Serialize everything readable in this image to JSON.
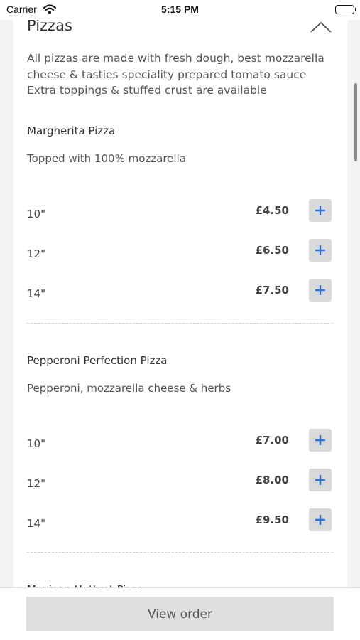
{
  "status_bar": {
    "carrier": "Carrier",
    "time": "5:15 PM"
  },
  "section": {
    "title": "Pizzas",
    "description": "All pizzas are made with fresh dough, best mozzarella cheese & tasties speciality prepared tomato sauce Extra toppings & stuffed crust are available"
  },
  "items": [
    {
      "name": "Margherita Pizza",
      "description": "Topped with 100% mozzarella",
      "sizes": [
        {
          "label": "10\"",
          "price": "£4.50"
        },
        {
          "label": "12\"",
          "price": "£6.50"
        },
        {
          "label": "14\"",
          "price": "£7.50"
        }
      ]
    },
    {
      "name": "Pepperoni Perfection Pizza",
      "description": "Pepperoni, mozzarella cheese & herbs",
      "sizes": [
        {
          "label": "10\"",
          "price": "£7.00"
        },
        {
          "label": "12\"",
          "price": "£8.00"
        },
        {
          "label": "14\"",
          "price": "£9.50"
        }
      ]
    }
  ],
  "next_item_partial": "Mexican Hottest Pizza",
  "footer": {
    "view_order_label": "View order"
  },
  "colors": {
    "accent": "#2f6fd0",
    "add_button_bg": "#d9d9d9"
  },
  "icons": {
    "collapse": "chevron-up-icon",
    "add": "plus-icon",
    "wifi": "wifi-icon",
    "battery": "battery-icon"
  }
}
